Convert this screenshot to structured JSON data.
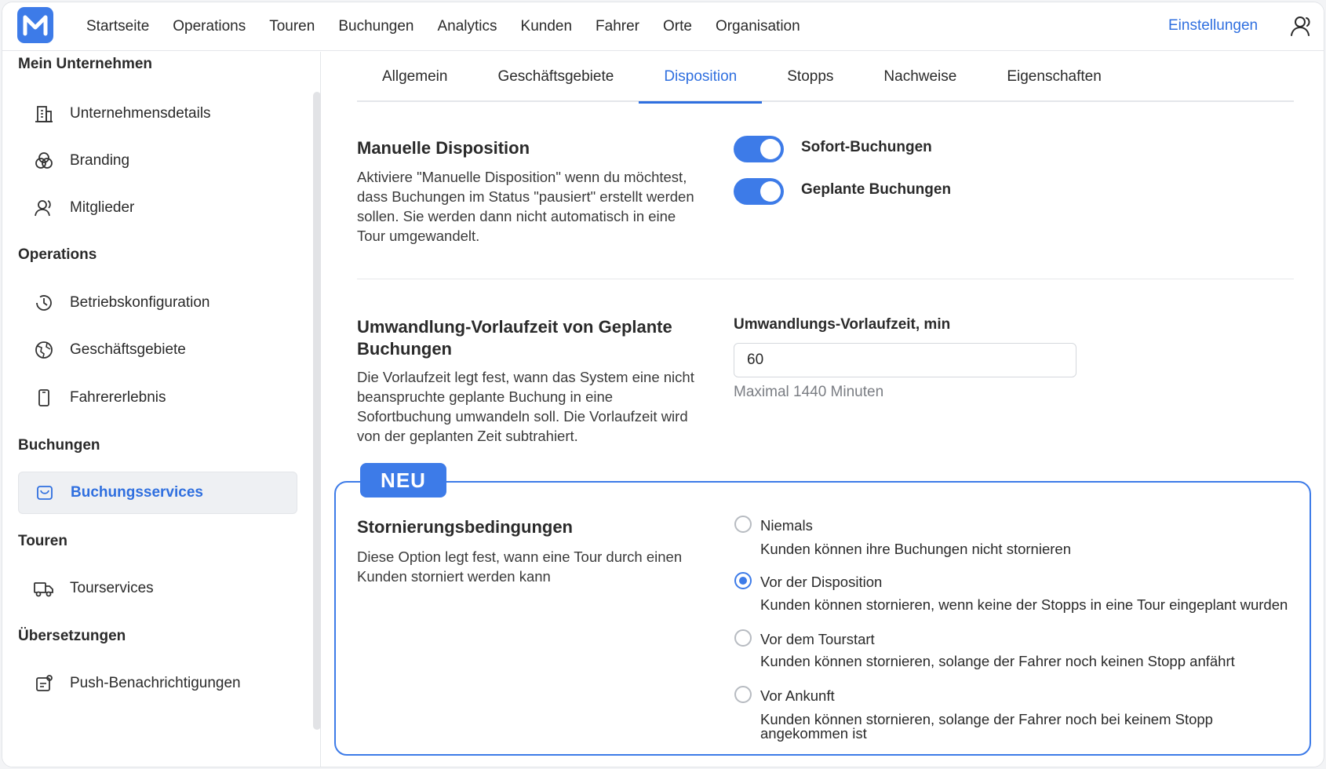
{
  "topbar": {
    "nav": [
      "Startseite",
      "Operations",
      "Touren",
      "Buchungen",
      "Analytics",
      "Kunden",
      "Fahrer",
      "Orte",
      "Organisation"
    ],
    "settings": "Einstellungen"
  },
  "sidebar": {
    "sections": {
      "company": "Mein Unternehmen",
      "operations": "Operations",
      "bookings": "Buchungen",
      "tours": "Touren",
      "translations": "Übersetzungen"
    },
    "items": {
      "company_details": "Unternehmensdetails",
      "branding": "Branding",
      "members": "Mitglieder",
      "operating_config": "Betriebskonfiguration",
      "business_areas": "Geschäftsgebiete",
      "driver_experience": "Fahrererlebnis",
      "booking_services": "Buchungsservices",
      "tour_services": "Tourservices",
      "push_notifications": "Push-Benachrichtigungen"
    }
  },
  "tabs": [
    "Allgemein",
    "Geschäftsgebiete",
    "Disposition",
    "Stopps",
    "Nachweise",
    "Eigenschaften"
  ],
  "manual_dispatch": {
    "title": "Manuelle Disposition",
    "description": "Aktiviere \"Manuelle Disposition\" wenn du möchtest, dass Buchungen im Status \"pausiert\" erstellt werden sollen. Sie werden dann nicht automatisch in eine Tour umgewandelt.",
    "toggle_instant": "Sofort-Buchungen",
    "toggle_planned": "Geplante Buchungen"
  },
  "lead_time": {
    "title": "Umwandlung-Vorlaufzeit von Geplante Buchungen",
    "description": "Die Vorlaufzeit legt fest, wann das System eine nicht beanspruchte geplante Buchung in eine Sofortbuchung umwandeln soll. Die Vorlaufzeit wird von der geplanten Zeit subtrahiert.",
    "field_label": "Umwandlungs-Vorlaufzeit, min",
    "value": "60",
    "hint": "Maximal 1440 Minuten"
  },
  "cancellation": {
    "badge": "NEU",
    "title": "Stornierungsbedingungen",
    "description": "Diese Option legt fest, wann eine Tour durch einen Kunden storniert werden kann",
    "options": [
      {
        "label": "Niemals",
        "desc": "Kunden können ihre Buchungen nicht stornieren"
      },
      {
        "label": "Vor der Disposition",
        "desc": "Kunden können stornieren, wenn keine der Stopps in eine Tour eingeplant wurden"
      },
      {
        "label": "Vor dem Tourstart",
        "desc": "Kunden können stornieren, solange der Fahrer noch keinen Stopp anfährt"
      },
      {
        "label": "Vor Ankunft",
        "desc": "Kunden können stornieren, solange der Fahrer noch bei keinem Stopp angekommen ist"
      }
    ],
    "selected": "Vor der Disposition"
  },
  "colors": {
    "accent": "#3d7be8",
    "link": "#2f6fdf"
  }
}
